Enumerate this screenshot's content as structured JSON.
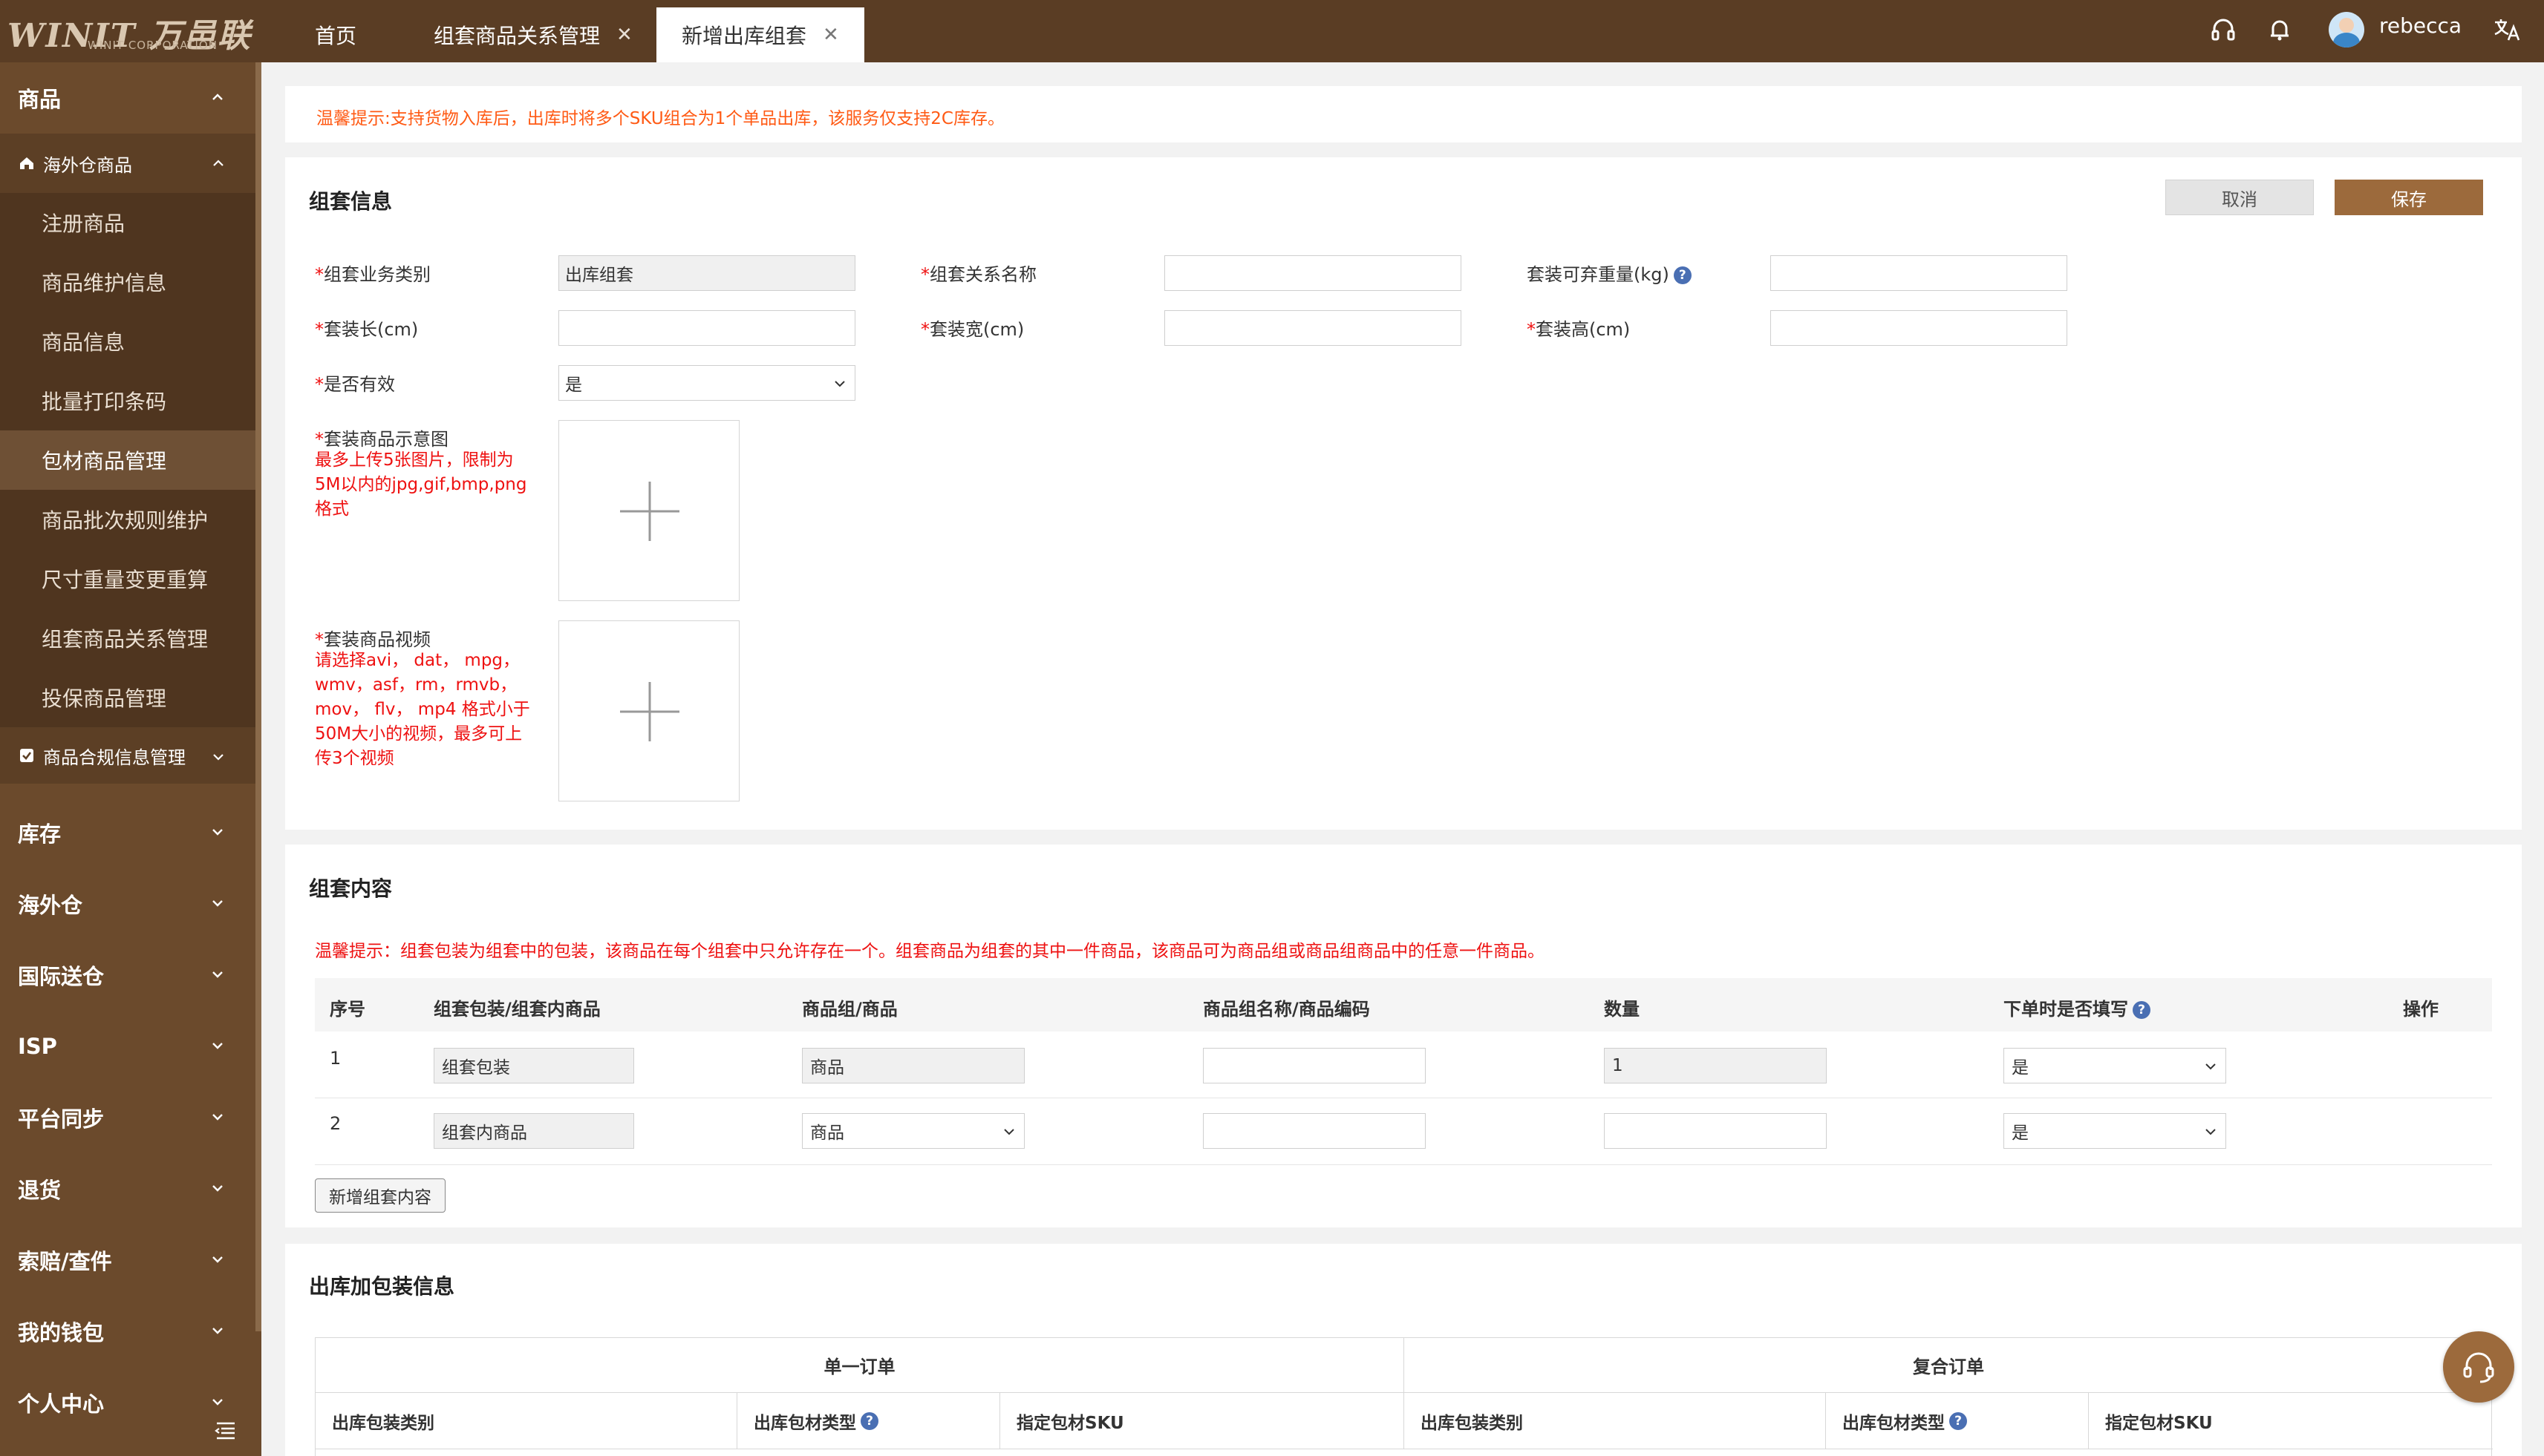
{
  "brand": {
    "logo_text": "WINIT 万邑联",
    "logo_sub": "WINIT CORPORATION"
  },
  "tabs": [
    {
      "label": "首页"
    },
    {
      "label": "组套商品关系管理"
    },
    {
      "label": "新增出库组套"
    }
  ],
  "user": {
    "name": "rebecca"
  },
  "sidebar": {
    "goods": "商品",
    "overseas_goods": "海外仓商品",
    "items": [
      {
        "label": "注册商品"
      },
      {
        "label": "商品维护信息"
      },
      {
        "label": "商品信息"
      },
      {
        "label": "批量打印条码"
      },
      {
        "label": "包材商品管理"
      },
      {
        "label": "商品批次规则维护"
      },
      {
        "label": "尺寸重量变更重算"
      },
      {
        "label": "组套商品关系管理"
      },
      {
        "label": "投保商品管理"
      }
    ],
    "compliance": "商品合规信息管理",
    "groups": [
      {
        "label": "库存"
      },
      {
        "label": "海外仓"
      },
      {
        "label": "国际送仓"
      },
      {
        "label": "ISP"
      },
      {
        "label": "平台同步"
      },
      {
        "label": "退货"
      },
      {
        "label": "索赔/查件"
      },
      {
        "label": "我的钱包"
      },
      {
        "label": "个人中心"
      }
    ]
  },
  "tip": "温馨提示:支持货物入库后，出库时将多个SKU组合为1个单品出库，该服务仅支持2C库存。",
  "info": {
    "title": "组套信息",
    "cancel": "取消",
    "save": "保存",
    "required_mark": "*",
    "fields": {
      "business_type": {
        "label": "组套业务类别",
        "value": "出库组套"
      },
      "relation_name": {
        "label": "组套关系名称",
        "value": ""
      },
      "discard_weight": {
        "label": "套装可弃重量(kg)",
        "value": ""
      },
      "length": {
        "label": "套装长(cm)",
        "value": ""
      },
      "width": {
        "label": "套装宽(cm)",
        "value": ""
      },
      "height": {
        "label": "套装高(cm)",
        "value": ""
      },
      "valid": {
        "label": "是否有效",
        "value": "是"
      },
      "image": {
        "label": "套装商品示意图",
        "hint": "最多上传5张图片，限制为5M以内的jpg,gif,bmp,png格式"
      },
      "video": {
        "label": "套装商品视频",
        "hint": "请选择avi， dat， mpg，wmv，asf，rm，rmvb，mov， flv， mp4 格式小于50M大小的视频，最多可上传3个视频"
      }
    }
  },
  "content": {
    "title": "组套内容",
    "tip": "温馨提示：组套包装为组套中的包装，该商品在每个组套中只允许存在一个。组套商品为组套的其中一件商品，该商品可为商品组或商品组商品中的任意一件商品。",
    "headers": [
      "序号",
      "组套包装/组套内商品",
      "商品组/商品",
      "商品组名称/商品编码",
      "数量",
      "下单时是否填写",
      "操作"
    ],
    "rows": [
      {
        "index": "1",
        "type": "组套包装",
        "goods": "商品",
        "code": "",
        "qty": "1",
        "fill": "是"
      },
      {
        "index": "2",
        "type": "组套内商品",
        "goods": "商品",
        "code": "",
        "qty": "",
        "fill": "是"
      }
    ],
    "add_button": "新增组套内容"
  },
  "outbound": {
    "title": "出库加包装信息",
    "single": "单一订单",
    "composite": "复合订单",
    "columns": [
      "出库包装类别",
      "出库包材类型",
      "指定包材SKU"
    ]
  },
  "colors": {
    "topbar": "#5a3d24",
    "sidebar": "#6b4a2c",
    "accent": "#9c6a3c",
    "tip_orange": "#ff5a14",
    "required_red": "#e11"
  }
}
